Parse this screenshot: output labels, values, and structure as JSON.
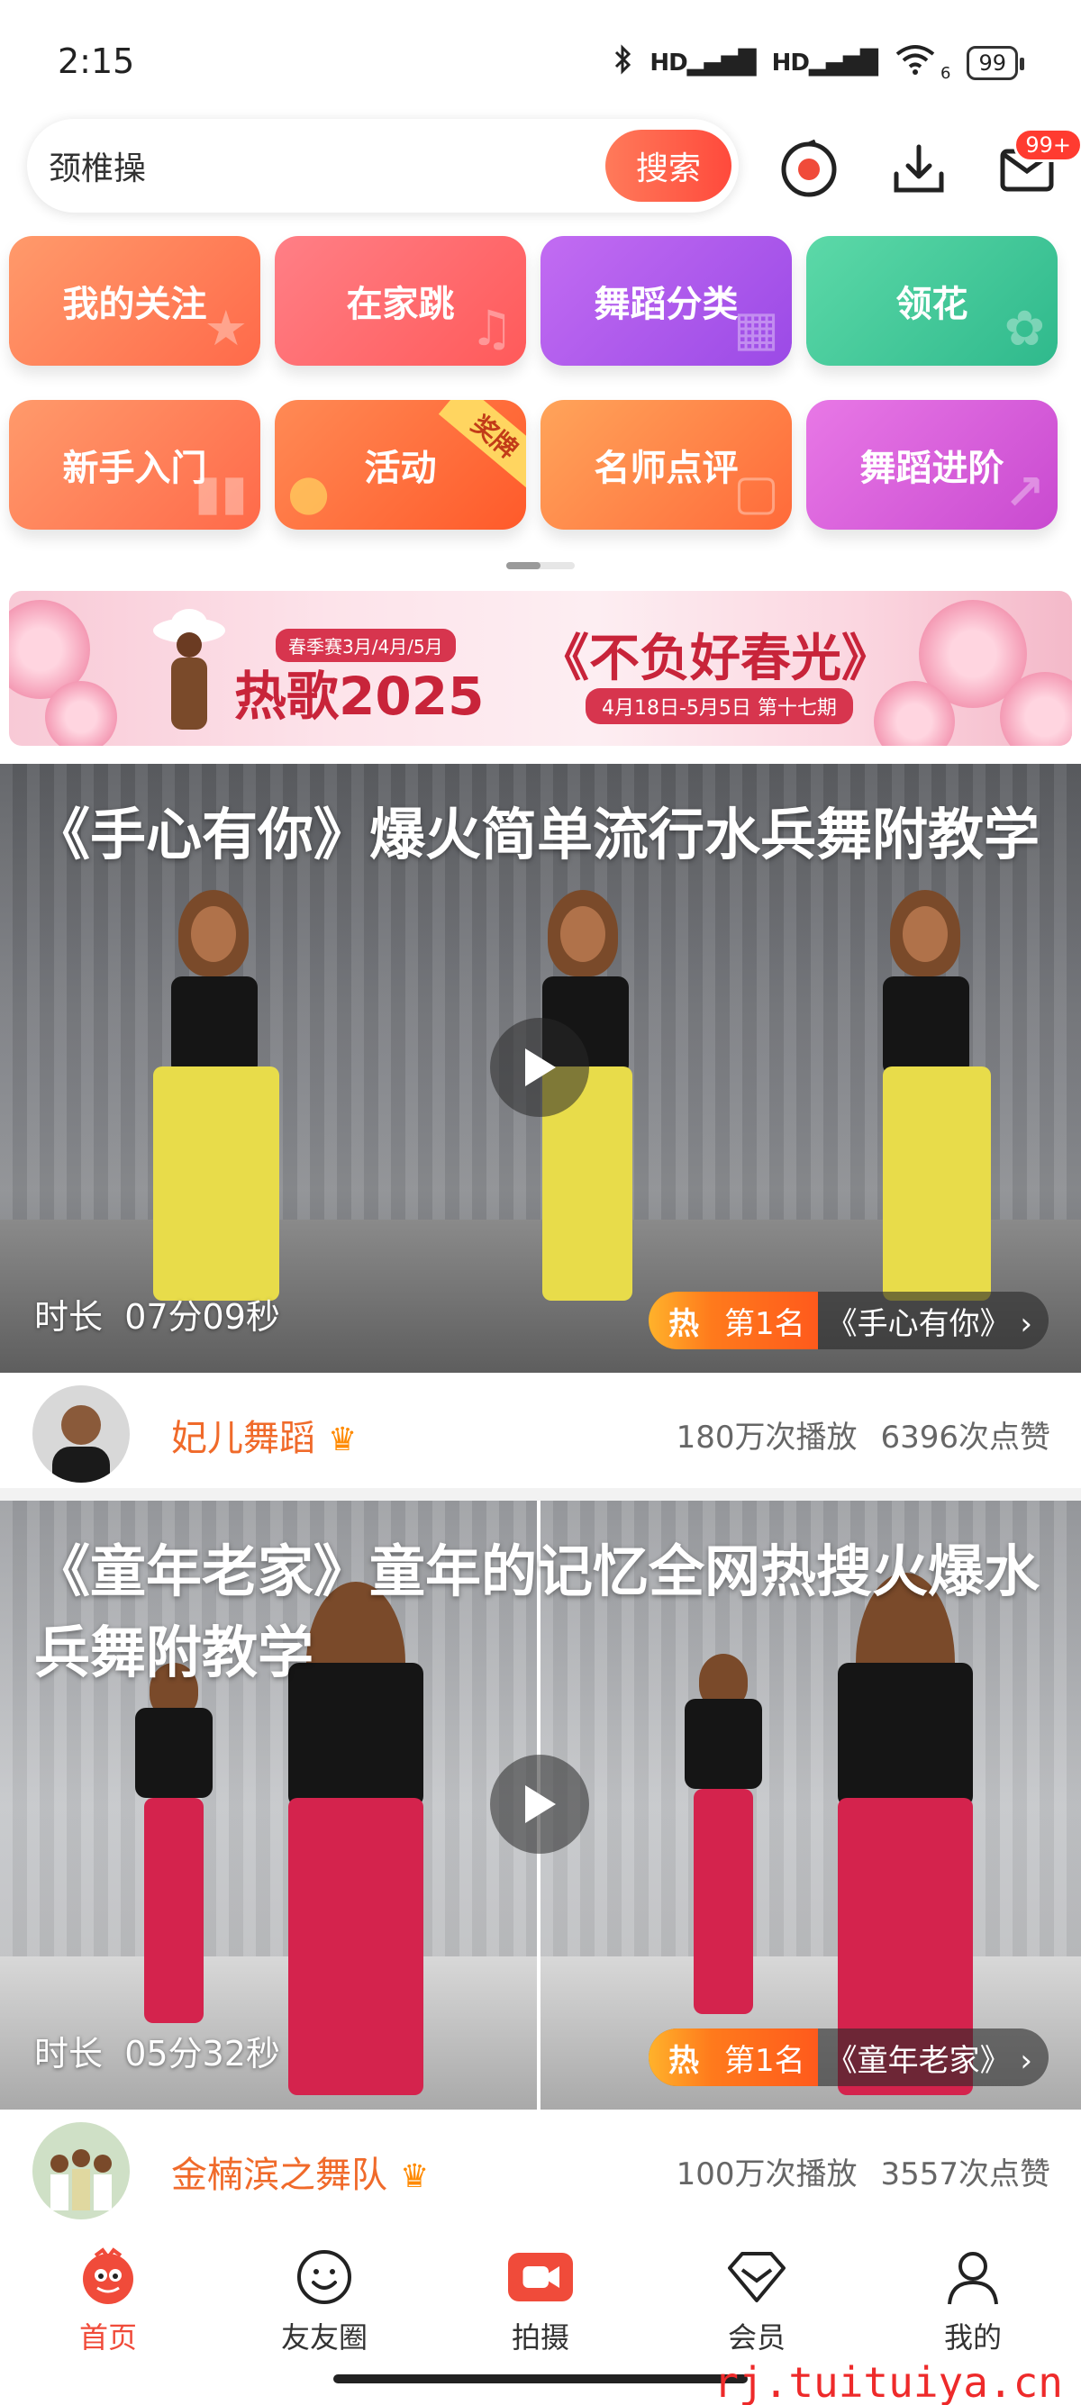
{
  "status_bar": {
    "time": "2:15",
    "signal1": "HD",
    "signal2": "HD",
    "wifi_sub": "6",
    "battery": "99"
  },
  "search": {
    "value": "颈椎操",
    "button": "搜索",
    "mail_badge": "99+"
  },
  "categories_row1": [
    {
      "label": "我的关注",
      "color_from": "#ff9a6b",
      "color_to": "#ff6a4a"
    },
    {
      "label": "在家跳",
      "color_from": "#ff7f86",
      "color_to": "#ff5a5a"
    },
    {
      "label": "舞蹈分类",
      "color_from": "#c26cf2",
      "color_to": "#9b4ae6"
    },
    {
      "label": "领花",
      "color_from": "#5cd9a8",
      "color_to": "#2fb98c"
    }
  ],
  "categories_row2": [
    {
      "label": "新手入门",
      "color_from": "#ff9a6b",
      "color_to": "#ff6a4a"
    },
    {
      "label": "活动",
      "ribbon": "奖牌",
      "color_from": "#ff8a55",
      "color_to": "#ff5a2a"
    },
    {
      "label": "名师点评",
      "color_from": "#ffa45a",
      "color_to": "#ff6a3a"
    },
    {
      "label": "舞蹈进阶",
      "color_from": "#e878e6",
      "color_to": "#c94ad0"
    }
  ],
  "banner": {
    "tag": "春季赛3月/4月/5月",
    "hot": "热歌2025",
    "title": "《不负好春光》",
    "date": "4月18日-5月5日 第十七期"
  },
  "videos": [
    {
      "title": "《手心有你》爆火简单流行水兵舞附教学",
      "duration_label": "时长",
      "duration": "07分09秒",
      "hot": "热",
      "rank": "第1名",
      "song": "《手心有你》",
      "author": "妃儿舞蹈",
      "plays": "180万次播放",
      "likes": "6396次点赞"
    },
    {
      "title": "《童年老家》童年的记忆全网热搜火爆水兵舞附教学",
      "duration_label": "时长",
      "duration": "05分32秒",
      "hot": "热",
      "rank": "第1名",
      "song": "《童年老家》",
      "author": "金楠滨之舞队",
      "plays": "100万次播放",
      "likes": "3557次点赞"
    }
  ],
  "nav": [
    {
      "label": "首页",
      "icon": "home-icon",
      "active": true
    },
    {
      "label": "友友圈",
      "icon": "smile-icon"
    },
    {
      "label": "拍摄",
      "icon": "camera-icon"
    },
    {
      "label": "会员",
      "icon": "diamond-icon"
    },
    {
      "label": "我的",
      "icon": "person-icon"
    }
  ],
  "watermark": "rj.tuituiya.cn",
  "colors": {
    "accent": "#f04b3a",
    "author_name": "#f06a2a"
  }
}
